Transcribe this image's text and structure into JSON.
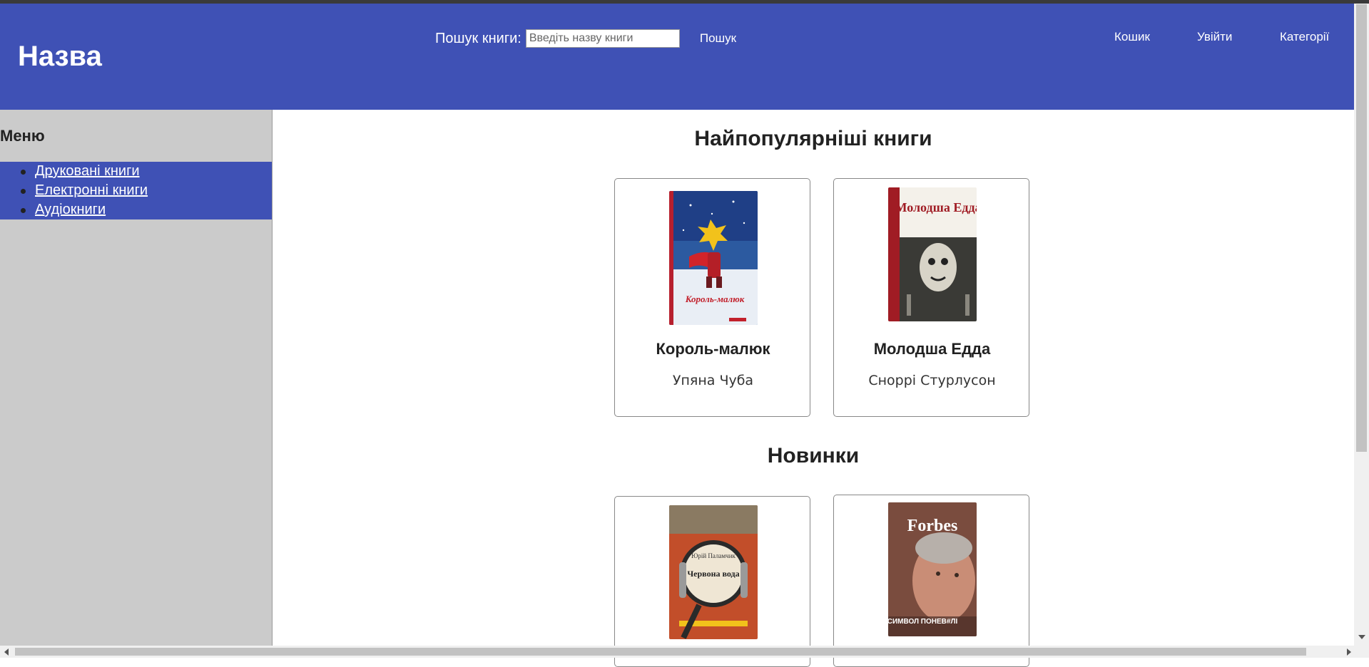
{
  "header": {
    "brand": "Назва",
    "search_label": "Пошук книги:",
    "search_placeholder": "Введіть назву книги",
    "search_button": "Пошук",
    "nav": [
      "Кошик",
      "Увійти",
      "Категорії"
    ]
  },
  "sidebar": {
    "title": "Меню",
    "items": [
      "Друковані книги",
      "Електронні книги",
      "Аудіокниги"
    ]
  },
  "sections": {
    "popular": {
      "title": "Найпопулярніші книги",
      "books": [
        {
          "title": "Король-малюк",
          "author": "Упяна Чуба",
          "cover_text": "Король-малюк"
        },
        {
          "title": "Молодша Едда",
          "author": "Сноррі Стурлусон",
          "cover_text": "Молодша Едда"
        }
      ]
    },
    "new": {
      "title": "Новинки",
      "books": [
        {
          "cover_text": "Червона вода",
          "cover_subtitle": "Юрій Паламчик"
        },
        {
          "cover_text": "Forbes",
          "cover_subtitle": "СИМВОЛ ПОНЕВ#ЛІ"
        }
      ]
    }
  },
  "colors": {
    "accent": "#3f51b5",
    "sidebar_bg": "#cbcbcb"
  }
}
